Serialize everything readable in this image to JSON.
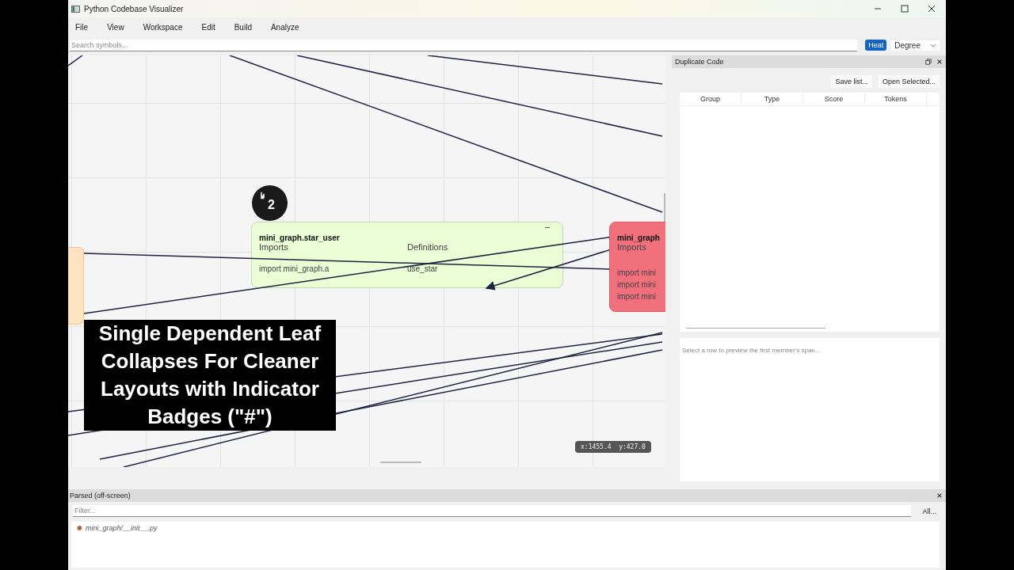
{
  "window": {
    "title": "Python Codebase Visualizer"
  },
  "menu": [
    "File",
    "View",
    "Workspace",
    "Edit",
    "Build",
    "Analyze"
  ],
  "search": {
    "placeholder": "Search symbols..."
  },
  "heat_toggle": {
    "label": "Heat",
    "selected": true
  },
  "metric_combo": {
    "value": "Degree"
  },
  "canvas": {
    "nodes": [
      {
        "kind": "module",
        "title": "mini_graph.star_user",
        "color": "#eafdd5",
        "columns": [
          {
            "heading": "Imports",
            "items": [
              "import mini_graph.a"
            ]
          },
          {
            "heading": "Definitions",
            "items": [
              "use_star"
            ]
          }
        ]
      },
      {
        "kind": "module",
        "title": "mini_graph",
        "color": "#f0707c",
        "columns": [
          {
            "heading": "Imports",
            "items": [
              "import mini",
              "import mini",
              "import mini"
            ]
          }
        ]
      },
      {
        "kind": "stub",
        "color": "#fde3c0"
      }
    ],
    "badge": {
      "count": "2"
    },
    "coordinates": "x:1455.4  y:427.0",
    "caption": "Single Dependent Leaf Collapses For Cleaner Layouts with Indicator Badges (\"#\")"
  },
  "duplicate_panel": {
    "title": "Duplicate Code",
    "buttons": [
      "Save list...",
      "Open Selected..."
    ],
    "columns": [
      "Group",
      "Type",
      "Score",
      "Tokens"
    ],
    "preview_placeholder": "Select a row to preview the first member's span..."
  },
  "parsed_panel": {
    "title": "Parsed (off-screen)",
    "filter_placeholder": "Filter...",
    "all_button": "All...",
    "files": [
      "mini_graph/__init__.py"
    ]
  }
}
